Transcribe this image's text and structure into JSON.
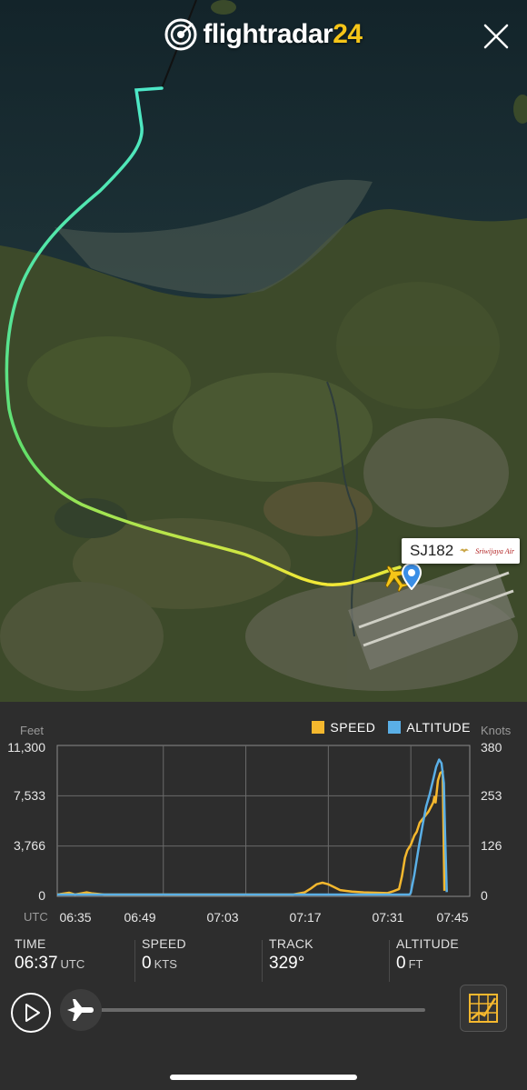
{
  "header": {
    "logo_text": "flightradar",
    "logo_number": "24"
  },
  "map": {
    "flight_label": {
      "callsign": "SJ182",
      "airline_logo_text": "Sriwijaya Air"
    },
    "track_colors": [
      "#4de8c8",
      "#55e59a",
      "#66e066",
      "#b7e84a",
      "#f3e837"
    ]
  },
  "chart": {
    "left_axis_title": "Feet",
    "right_axis_title": "Knots",
    "x_axis_title": "UTC",
    "legend": [
      {
        "label": "SPEED",
        "color": "#f5b82e"
      },
      {
        "label": "ALTITUDE",
        "color": "#5aafe6"
      }
    ]
  },
  "chart_data": {
    "type": "line",
    "x": [
      "06:35",
      "06:49",
      "07:03",
      "07:17",
      "07:31",
      "07:45"
    ],
    "left_ticks": [
      "0",
      "3,766",
      "7,533",
      "11,300"
    ],
    "right_ticks": [
      "0",
      "126",
      "253",
      "380"
    ],
    "ylim_feet": [
      0,
      11300
    ],
    "ylim_knots": [
      0,
      380
    ],
    "series": [
      {
        "name": "SPEED",
        "color": "#f5b82e",
        "x_minutes": [
          0,
          2,
          3,
          5,
          6,
          8,
          40,
          42,
          43,
          44,
          45,
          46,
          47,
          48,
          50,
          52,
          56,
          57,
          58,
          58.5,
          59,
          59.4,
          60,
          60.6,
          61,
          61.5,
          62,
          62.5,
          63,
          63.5,
          63.8,
          64,
          64.2,
          64.6,
          65,
          65.4,
          65.7
        ],
        "values": [
          0,
          5,
          0,
          6,
          3,
          0,
          0,
          6,
          16,
          28,
          32,
          28,
          20,
          12,
          8,
          6,
          4,
          9,
          15,
          50,
          100,
          120,
          135,
          160,
          170,
          195,
          205,
          215,
          225,
          240,
          250,
          265,
          250,
          310,
          330,
          335,
          10
        ]
      },
      {
        "name": "ALTITUDE",
        "color": "#5aafe6",
        "x_minutes": [
          0,
          59.8,
          60,
          60.6,
          61.3,
          62,
          62.6,
          63.2,
          63.8,
          64.3,
          64.8,
          65.2,
          65.6,
          65.8,
          66.1
        ],
        "values": [
          0,
          0,
          150,
          1600,
          3700,
          5600,
          7100,
          8100,
          9300,
          10300,
          10900,
          10600,
          9000,
          5000,
          200
        ]
      }
    ],
    "x_range_minutes": [
      0,
      70
    ]
  },
  "stats": [
    {
      "label": "TIME",
      "value": "06:37",
      "unit": "UTC"
    },
    {
      "label": "SPEED",
      "value": "0",
      "unit": "KTS"
    },
    {
      "label": "TRACK",
      "value": "329°",
      "unit": ""
    },
    {
      "label": "ALTITUDE",
      "value": "0",
      "unit": "FT"
    }
  ],
  "playback": {
    "progress": 0.0
  }
}
